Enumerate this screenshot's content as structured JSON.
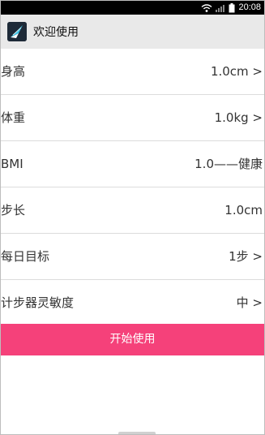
{
  "status_bar": {
    "time": "20:08",
    "icons": [
      "wifi-icon",
      "signal-icon",
      "battery-icon"
    ]
  },
  "header": {
    "title": "欢迎使用",
    "icon": "app-logo-icon"
  },
  "settings": {
    "height": {
      "label": "身高",
      "value": "1.0cm >"
    },
    "weight": {
      "label": "体重",
      "value": "1.0kg >"
    },
    "bmi": {
      "label": "BMI",
      "value": "1.0——健康"
    },
    "stride": {
      "label": "步长",
      "value": "1.0cm"
    },
    "daily_goal": {
      "label": "每日目标",
      "value": "1步 >"
    },
    "sensitivity": {
      "label": "计步器灵敏度",
      "value": "中 >"
    }
  },
  "start_button": {
    "label": "开始使用"
  },
  "colors": {
    "accent": "#f5417a",
    "header_bg": "#e9e9e9",
    "status_bar_bg": "#000000"
  }
}
